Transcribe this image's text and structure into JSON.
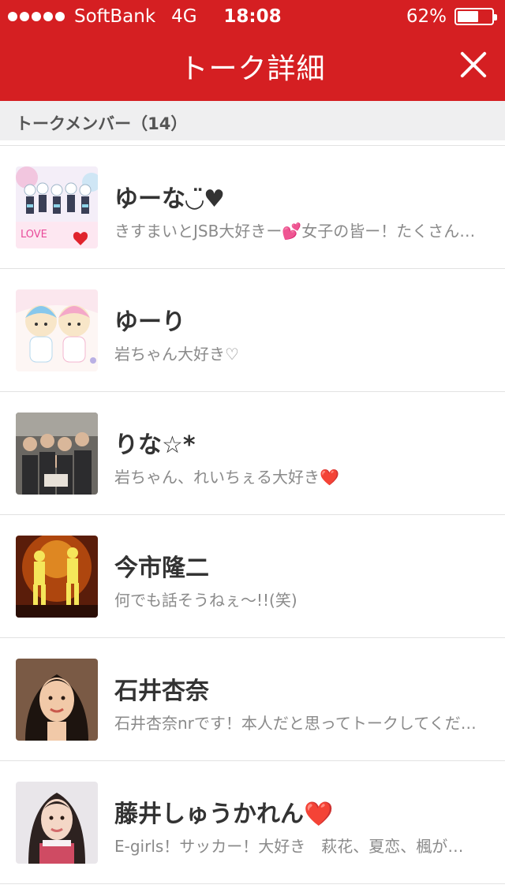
{
  "status_bar": {
    "carrier": "SoftBank",
    "network": "4G",
    "time": "18:08",
    "battery_percent": "62%",
    "battery_level": 0.62
  },
  "header": {
    "title": "トーク詳細",
    "close_icon": "close-icon"
  },
  "section": {
    "title": "トークメンバー（14）"
  },
  "members": [
    {
      "name": "ゆーな◡̈♥",
      "status": "きすまいとJSB大好きー💕女子の皆ー！たくさん話そうね"
    },
    {
      "name": "ゆーり",
      "status": "岩ちゃん大好き♡"
    },
    {
      "name": "りな☆*",
      "status": "岩ちゃん、れいちぇる大好き❤️"
    },
    {
      "name": "今市隆二",
      "status": "何でも話そうねぇ〜!!(笑)"
    },
    {
      "name": "石井杏奈",
      "status": "石井杏奈nrです！本人だと思ってトークしてください"
    },
    {
      "name": "藤井しゅうかれん❤️",
      "status": "E-girls！サッカー！大好き　萩花、夏恋、楓が特に好き"
    }
  ]
}
